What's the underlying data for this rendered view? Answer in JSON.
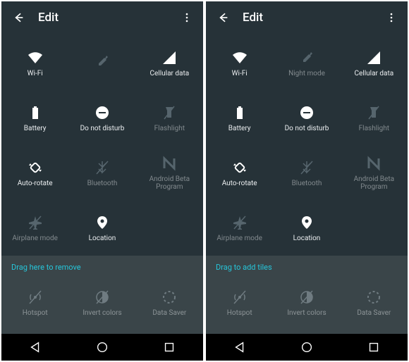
{
  "panels": [
    {
      "title": "Edit",
      "tiles": [
        {
          "name": "wifi",
          "label": "Wi-Fi",
          "icon": "wifi",
          "dim": false
        },
        {
          "name": "eyedropper",
          "label": "",
          "icon": "eyedropper",
          "dim": true
        },
        {
          "name": "cellular",
          "label": "Cellular data",
          "icon": "signal",
          "dim": false
        },
        {
          "name": "battery",
          "label": "Battery",
          "icon": "battery",
          "dim": false
        },
        {
          "name": "dnd",
          "label": "Do not disturb",
          "icon": "dnd",
          "dim": false
        },
        {
          "name": "flashlight",
          "label": "Flashlight",
          "icon": "flashlight",
          "dim": true
        },
        {
          "name": "autorotate",
          "label": "Auto-rotate",
          "icon": "rotate",
          "dim": false
        },
        {
          "name": "bluetooth",
          "label": "Bluetooth",
          "icon": "bluetooth",
          "dim": true
        },
        {
          "name": "beta",
          "label": "Android Beta Program",
          "icon": "nlogo",
          "dim": true
        },
        {
          "name": "airplane",
          "label": "Airplane mode",
          "icon": "airplane",
          "dim": true
        },
        {
          "name": "location",
          "label": "Location",
          "icon": "location",
          "dim": false
        }
      ],
      "hint": "Drag here to remove",
      "removed": [
        {
          "name": "hotspot",
          "label": "Hotspot",
          "icon": "hotspot"
        },
        {
          "name": "invert",
          "label": "Invert colors",
          "icon": "invert"
        },
        {
          "name": "datasaver",
          "label": "Data Saver",
          "icon": "datasaver"
        }
      ]
    },
    {
      "title": "Edit",
      "tiles": [
        {
          "name": "wifi",
          "label": "Wi-Fi",
          "icon": "wifi",
          "dim": false
        },
        {
          "name": "nightmode",
          "label": "Night mode",
          "icon": "eyedropper",
          "dim": true
        },
        {
          "name": "cellular",
          "label": "Cellular data",
          "icon": "signal",
          "dim": false
        },
        {
          "name": "battery",
          "label": "Battery",
          "icon": "battery",
          "dim": false
        },
        {
          "name": "dnd",
          "label": "Do not disturb",
          "icon": "dnd",
          "dim": false
        },
        {
          "name": "flashlight",
          "label": "Flashlight",
          "icon": "flashlight",
          "dim": true
        },
        {
          "name": "autorotate",
          "label": "Auto-rotate",
          "icon": "rotate",
          "dim": false
        },
        {
          "name": "bluetooth",
          "label": "Bluetooth",
          "icon": "bluetooth",
          "dim": true
        },
        {
          "name": "beta",
          "label": "Android Beta Program",
          "icon": "nlogo",
          "dim": true
        },
        {
          "name": "airplane",
          "label": "Airplane mode",
          "icon": "airplane",
          "dim": true
        },
        {
          "name": "location",
          "label": "Location",
          "icon": "location",
          "dim": false
        }
      ],
      "hint": "Drag to add tiles",
      "removed": [
        {
          "name": "hotspot",
          "label": "Hotspot",
          "icon": "hotspot"
        },
        {
          "name": "invert",
          "label": "Invert colors",
          "icon": "invert"
        },
        {
          "name": "datasaver",
          "label": "Data Saver",
          "icon": "datasaver"
        }
      ]
    }
  ]
}
